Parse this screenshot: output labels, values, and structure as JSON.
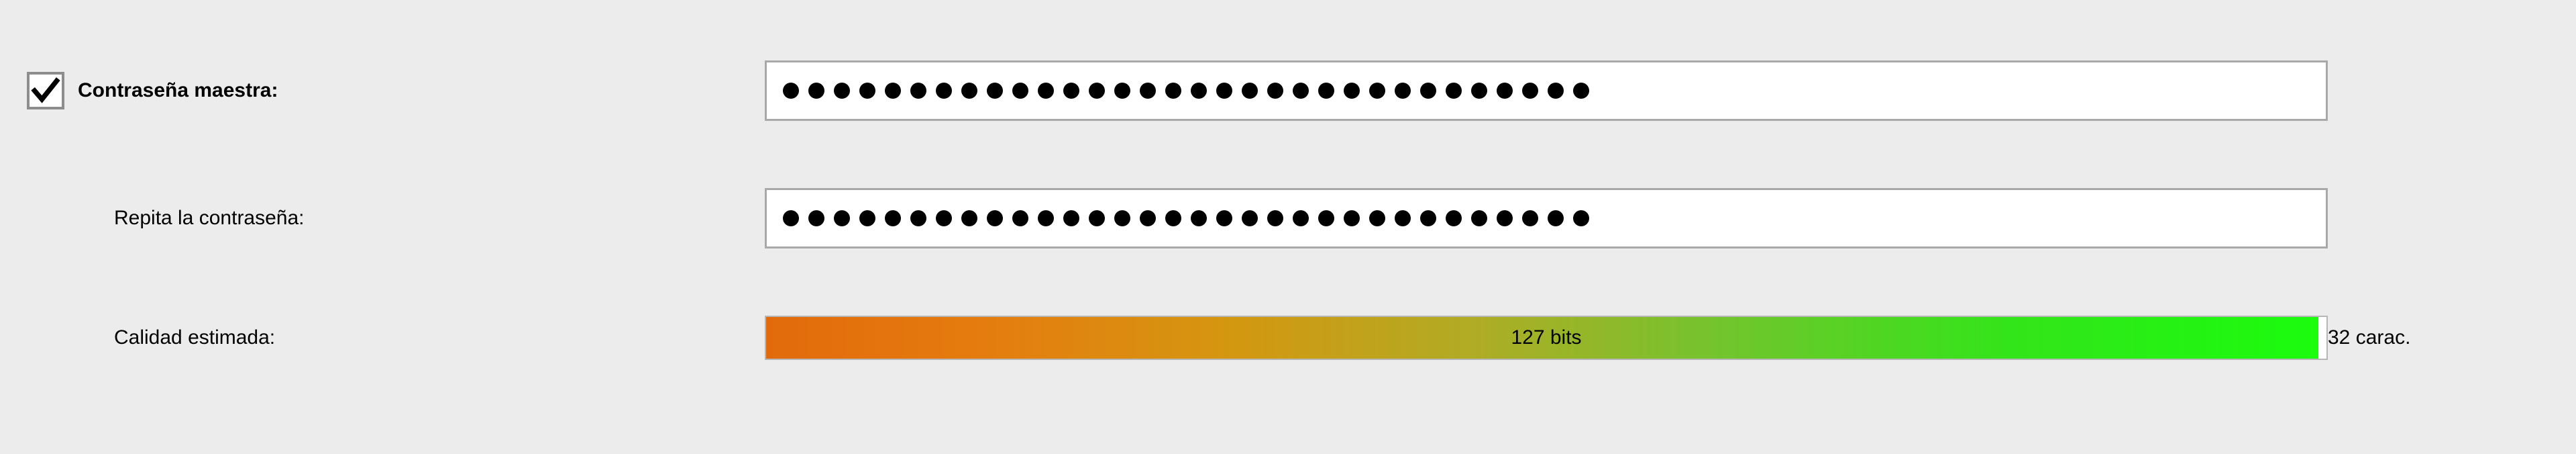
{
  "master": {
    "label": "Contraseña maestra:",
    "enabled": true,
    "length": 32
  },
  "repeat": {
    "label": "Repita la contraseña:",
    "length": 32
  },
  "quality": {
    "label": "Calidad estimada:",
    "bits_text": "127 bits",
    "bits": 127,
    "fill_percent": 99.5,
    "char_count_text": "32 carac."
  }
}
